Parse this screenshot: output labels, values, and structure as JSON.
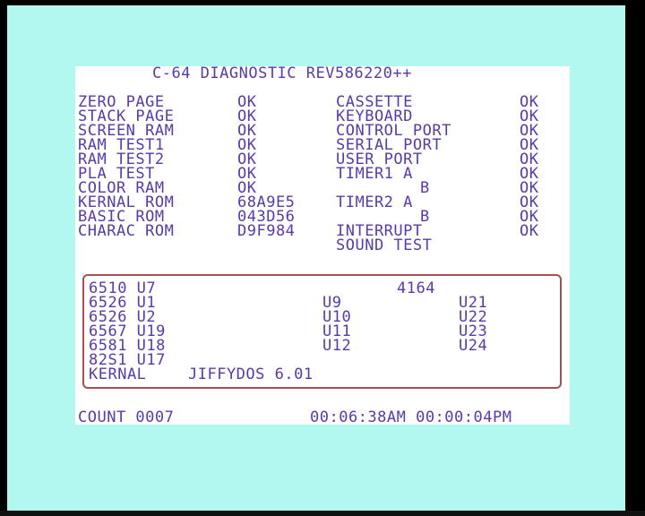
{
  "title": "C-64 DIAGNOSTIC REV586220++",
  "left_tests": [
    {
      "label": "ZERO PAGE",
      "result": "OK"
    },
    {
      "label": "STACK PAGE",
      "result": "OK"
    },
    {
      "label": "SCREEN RAM",
      "result": "OK"
    },
    {
      "label": "RAM TEST1",
      "result": "OK"
    },
    {
      "label": "RAM TEST2",
      "result": "OK"
    },
    {
      "label": "PLA TEST",
      "result": "OK"
    },
    {
      "label": "COLOR RAM",
      "result": "OK"
    },
    {
      "label": "KERNAL ROM",
      "result": "68A9E5"
    },
    {
      "label": "BASIC ROM",
      "result": "043D56"
    },
    {
      "label": "CHARAC ROM",
      "result": "D9F984"
    }
  ],
  "right_tests": [
    {
      "label": "CASSETTE",
      "result": "OK"
    },
    {
      "label": "KEYBOARD",
      "result": "OK"
    },
    {
      "label": "CONTROL PORT",
      "result": "OK"
    },
    {
      "label": "SERIAL PORT",
      "result": "OK"
    },
    {
      "label": "USER PORT",
      "result": "OK"
    },
    {
      "label": "TIMER1 A",
      "result": "OK"
    },
    {
      "label": "B",
      "result": "OK"
    },
    {
      "label": "TIMER2 A",
      "result": "OK"
    },
    {
      "label": "B",
      "result": "OK"
    },
    {
      "label": "INTERRUPT",
      "result": "OK"
    },
    {
      "label": "SOUND TEST",
      "result": ""
    }
  ],
  "chips": {
    "col1": [
      "6510 U7",
      "6526 U1",
      "6526 U2",
      "6567 U19",
      "6581 U18",
      "82S1 U17"
    ],
    "ram_header": "4164",
    "col2": [
      "U9",
      "U10",
      "U11",
      "U12"
    ],
    "col3": [
      "U21",
      "U22",
      "U23",
      "U24"
    ],
    "kernal_label": "KERNAL",
    "kernal_value": "JIFFYDOS 6.01"
  },
  "footer": {
    "count": "COUNT 0007",
    "times": "00:06:38AM 00:00:04PM"
  },
  "colors": {
    "border": "#b3f7f1",
    "text": "#5a3aa8",
    "box_border": "#a6504f",
    "screen": "#ffffff"
  }
}
